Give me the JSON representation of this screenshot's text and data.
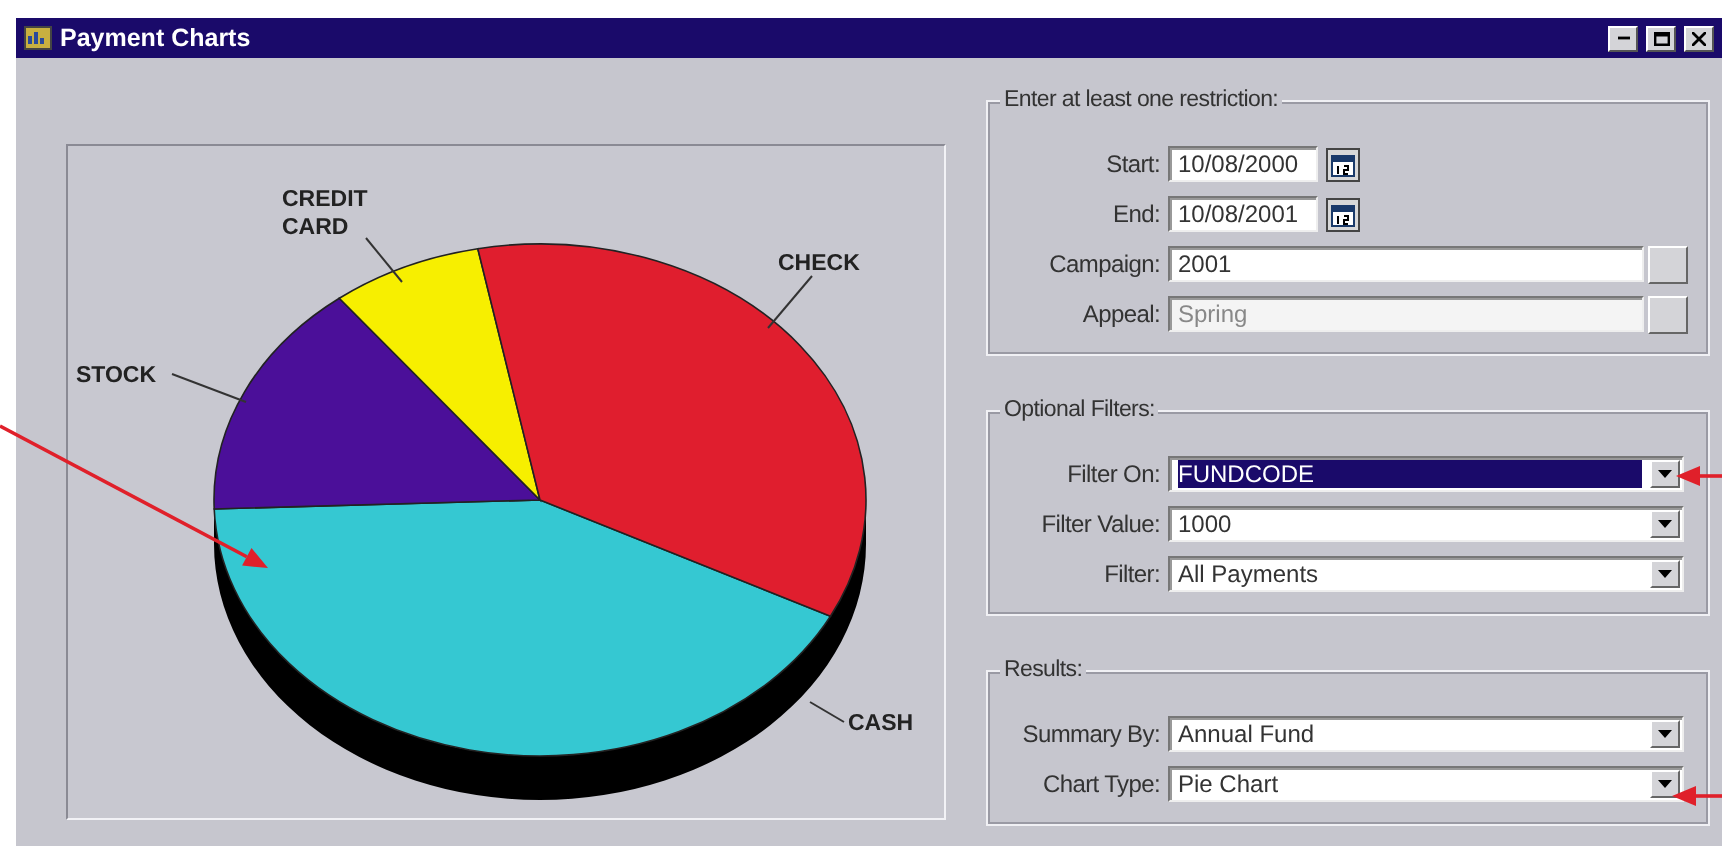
{
  "window": {
    "title": "Payment Charts"
  },
  "chart": {
    "slices": [
      {
        "label": "CASH",
        "color": "#35c8d2"
      },
      {
        "label": "STOCK",
        "color": "#4b0f99"
      },
      {
        "label": "CREDIT CARD",
        "color": "#f7ef00"
      },
      {
        "label": "CHECK",
        "color": "#e01e2e"
      }
    ]
  },
  "groups": [
    {
      "title": "Enter at least one restriction:",
      "fields": [
        {
          "kind": "date",
          "label": "Start:",
          "value": "10/08/2000",
          "disabled": false,
          "highlighted": false
        },
        {
          "kind": "date",
          "label": "End:",
          "value": "10/08/2001",
          "disabled": false,
          "highlighted": false
        },
        {
          "kind": "lookup",
          "label": "Campaign:",
          "value": "2001",
          "disabled": false,
          "highlighted": false
        },
        {
          "kind": "lookup",
          "label": "Appeal:",
          "value": "Spring",
          "disabled": true,
          "highlighted": false
        }
      ]
    },
    {
      "title": "Optional Filters:",
      "fields": [
        {
          "kind": "dropdown",
          "label": "Filter On:",
          "value": "FUNDCODE",
          "disabled": false,
          "highlighted": true
        },
        {
          "kind": "dropdown",
          "label": "Filter Value:",
          "value": "1000",
          "disabled": false,
          "highlighted": false
        },
        {
          "kind": "dropdown",
          "label": "Filter:",
          "value": "All Payments",
          "disabled": false,
          "highlighted": false
        }
      ]
    },
    {
      "title": "Results:",
      "fields": [
        {
          "kind": "dropdown",
          "label": "Summary By:",
          "value": "Annual Fund",
          "disabled": false,
          "highlighted": false
        },
        {
          "kind": "dropdown",
          "label": "Chart Type:",
          "value": "Pie Chart",
          "disabled": false,
          "highlighted": false
        }
      ]
    }
  ]
}
